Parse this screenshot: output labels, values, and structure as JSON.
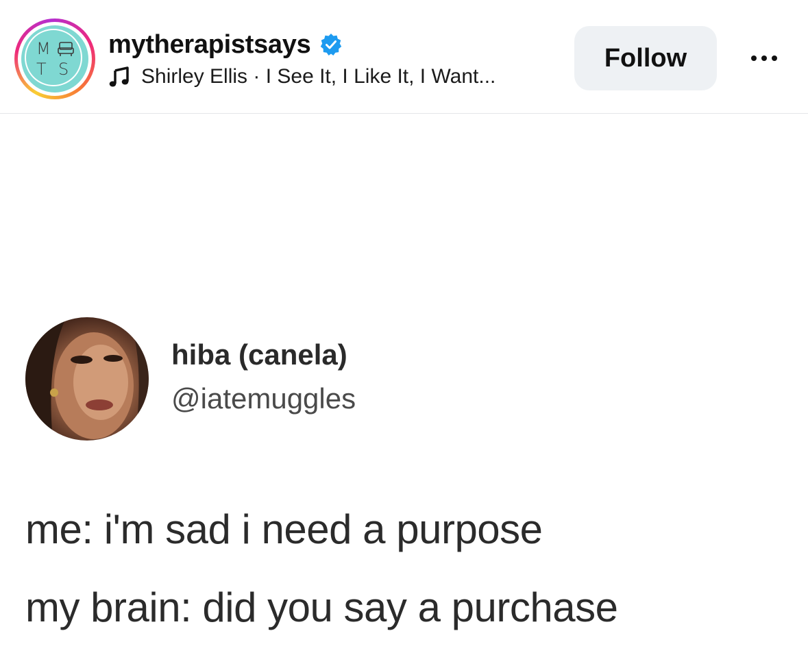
{
  "post_header": {
    "avatar_logo_letters": [
      "M",
      "T",
      "S"
    ],
    "username": "mytherapistsays",
    "verified_icon": "verified-badge-icon",
    "music_icon": "music-note-icon",
    "audio_track": "Shirley Ellis · I See It, I Like It, I Want...",
    "follow_label": "Follow",
    "more_icon": "more-options-icon"
  },
  "tweet": {
    "display_name": "hiba (canela)",
    "handle": "@iatemuggles",
    "line1": "me: i'm sad i need a purpose",
    "line2": "my brain: did you say a purchase"
  },
  "colors": {
    "verified_blue": "#1d9bf0",
    "logo_teal": "#7fd8d2",
    "follow_bg": "#eef1f4"
  }
}
